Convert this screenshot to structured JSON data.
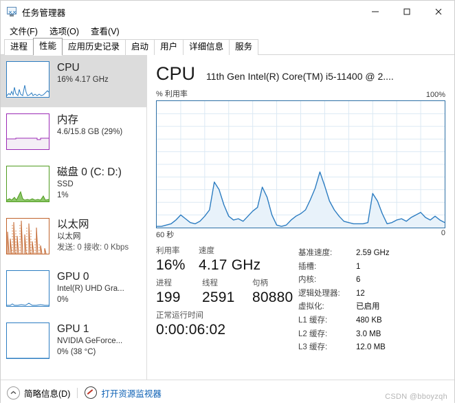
{
  "window": {
    "title": "任务管理器",
    "icon": "task-manager-monitor-icon",
    "minimize": "−",
    "maximize": "□",
    "close": "✕"
  },
  "menu": [
    {
      "label": "文件(F)",
      "key": "F"
    },
    {
      "label": "选项(O)",
      "key": "O"
    },
    {
      "label": "查看(V)",
      "key": "V"
    }
  ],
  "tabs": [
    {
      "label": "进程",
      "active": false
    },
    {
      "label": "性能",
      "active": true
    },
    {
      "label": "应用历史记录",
      "active": false
    },
    {
      "label": "启动",
      "active": false
    },
    {
      "label": "用户",
      "active": false
    },
    {
      "label": "详细信息",
      "active": false
    },
    {
      "label": "服务",
      "active": false
    }
  ],
  "sidebar": {
    "items": [
      {
        "title": "CPU",
        "sub1": "16%  4.17 GHz",
        "sub2": "",
        "color": "#2b7cc1",
        "selected": true
      },
      {
        "title": "内存",
        "sub1": "4.6/15.8 GB (29%)",
        "sub2": "",
        "color": "#9b29b5",
        "selected": false
      },
      {
        "title": "磁盘 0 (C: D:)",
        "sub1": "SSD",
        "sub2": "1%",
        "color": "#4f9b1e",
        "selected": false
      },
      {
        "title": "以太网",
        "sub1": "以太网",
        "sub2": "发送: 0 接收: 0 Kbps",
        "color": "#c0622a",
        "selected": false
      },
      {
        "title": "GPU 0",
        "sub1": "Intel(R) UHD Gra...",
        "sub2": "0%",
        "color": "#2b7cc1",
        "selected": false
      },
      {
        "title": "GPU 1",
        "sub1": "NVIDIA GeForce...",
        "sub2": "0% (38 °C)",
        "color": "#2b7cc1",
        "selected": false
      }
    ]
  },
  "main": {
    "title": "CPU",
    "subtitle": "11th Gen Intel(R) Core(TM) i5-11400 @ 2....",
    "graph_axis_label": "% 利用率",
    "graph_axis_max": "100%",
    "time_left": "60 秒",
    "time_right": "0",
    "stats": {
      "utilization_label": "利用率",
      "utilization_value": "16%",
      "speed_label": "速度",
      "speed_value": "4.17 GHz",
      "processes_label": "进程",
      "processes_value": "199",
      "threads_label": "线程",
      "threads_value": "2591",
      "handles_label": "句柄",
      "handles_value": "80880",
      "uptime_label": "正常运行时间",
      "uptime_value": "0:00:06:02"
    },
    "specs": [
      {
        "key": "基准速度:",
        "value": "2.59 GHz"
      },
      {
        "key": "插槽:",
        "value": "1"
      },
      {
        "key": "内核:",
        "value": "6"
      },
      {
        "key": "逻辑处理器:",
        "value": "12"
      },
      {
        "key": "虚拟化:",
        "value": "已启用"
      },
      {
        "key": "L1 缓存:",
        "value": "480 KB"
      },
      {
        "key": "L2 缓存:",
        "value": "3.0 MB"
      },
      {
        "key": "L3 缓存:",
        "value": "12.0 MB"
      }
    ]
  },
  "footer": {
    "fewer_details": "简略信息(D)",
    "resource_monitor": "打开资源监视器",
    "watermark": "CSDN @bboyzqh"
  },
  "chart_data": {
    "type": "area",
    "title": "CPU 利用率",
    "ylabel": "% 利用率",
    "xlabel": "60 秒",
    "ylim": [
      0,
      100
    ],
    "xlim": [
      0,
      60
    ],
    "grid": true,
    "line_color": "#2b7cc1",
    "fill_color": "#e8f2fa",
    "x": [
      0,
      1,
      2,
      3,
      4,
      5,
      6,
      7,
      8,
      9,
      10,
      11,
      12,
      13,
      14,
      15,
      16,
      17,
      18,
      19,
      20,
      21,
      22,
      23,
      24,
      25,
      26,
      27,
      28,
      29,
      30,
      31,
      32,
      33,
      34,
      35,
      36,
      37,
      38,
      39,
      40,
      41,
      42,
      43,
      44,
      45,
      46,
      47,
      48,
      49,
      50,
      51,
      52,
      53,
      54,
      55,
      56,
      57,
      58,
      59,
      60
    ],
    "values": [
      1,
      1,
      2,
      3,
      6,
      10,
      7,
      4,
      3,
      5,
      9,
      14,
      36,
      30,
      18,
      9,
      6,
      7,
      5,
      9,
      13,
      16,
      32,
      24,
      10,
      2,
      1,
      2,
      6,
      9,
      11,
      14,
      22,
      31,
      44,
      33,
      21,
      14,
      9,
      5,
      4,
      3,
      3,
      3,
      4,
      27,
      21,
      11,
      3,
      4,
      6,
      7,
      5,
      8,
      10,
      12,
      8,
      6,
      9,
      6,
      4
    ],
    "peaks": [
      {
        "x": 12,
        "y": 36
      },
      {
        "x": 22,
        "y": 32
      },
      {
        "x": 34,
        "y": 44
      },
      {
        "x": 45,
        "y": 27
      }
    ],
    "tail_rise": {
      "x": 57,
      "y": 14
    }
  }
}
